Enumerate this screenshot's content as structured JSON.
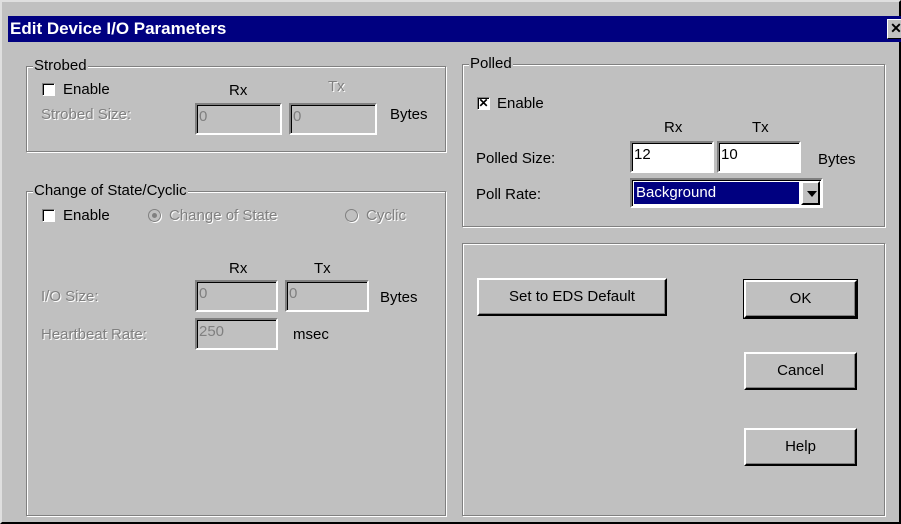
{
  "window": {
    "title": "Edit Device I/O Parameters",
    "close_label": "✕"
  },
  "strobed": {
    "legend": "Strobed",
    "enable_label": "Enable",
    "enable_checked": false,
    "rx_label": "Rx",
    "tx_label": "Tx",
    "size_label": "Strobed Size:",
    "rx_value": "0",
    "tx_value": "0",
    "bytes_label": "Bytes"
  },
  "cos": {
    "legend": "Change of State/Cyclic",
    "enable_label": "Enable",
    "enable_checked": false,
    "change_of_state_label": "Change of State",
    "cyclic_label": "Cyclic",
    "rx_label": "Rx",
    "tx_label": "Tx",
    "io_size_label": "I/O Size:",
    "rx_value": "0",
    "tx_value": "0",
    "bytes_label": "Bytes",
    "heartbeat_label": "Heartbeat Rate:",
    "heartbeat_value": "250",
    "msec_label": "msec"
  },
  "polled": {
    "legend": "Polled",
    "enable_label": "Enable",
    "enable_checked": true,
    "rx_label": "Rx",
    "tx_label": "Tx",
    "size_label": "Polled Size:",
    "rx_value": "12",
    "tx_value": "10",
    "bytes_label": "Bytes",
    "poll_rate_label": "Poll Rate:",
    "poll_rate_value": "Background"
  },
  "buttons": {
    "eds_default": "Set to EDS Default",
    "ok": "OK",
    "cancel": "Cancel",
    "help": "Help"
  },
  "colors": {
    "titlebar": "#000080",
    "face": "#c0c0c0",
    "selection": "#000080"
  }
}
